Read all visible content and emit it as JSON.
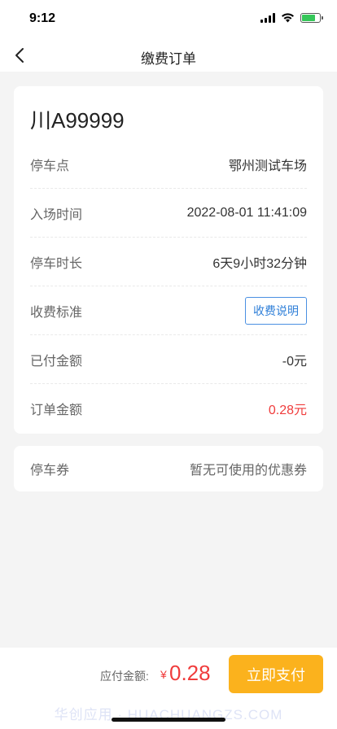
{
  "status_bar": {
    "time": "9:12",
    "battery_level": 0.75,
    "battery_color": "#35c759"
  },
  "nav": {
    "back_icon": "chevron-left-icon",
    "title": "缴费订单"
  },
  "order": {
    "plate": "川A99999",
    "rows": [
      {
        "label": "停车点",
        "value": "鄂州测试车场"
      },
      {
        "label": "入场时间",
        "value": "2022-08-01 11:41:09"
      },
      {
        "label": "停车时长",
        "value": "6天9小时32分钟"
      },
      {
        "label": "收费标准",
        "button": "收费说明"
      },
      {
        "label": "已付金额",
        "value": "-0元"
      },
      {
        "label": "订单金额",
        "value": "0.28元"
      }
    ]
  },
  "coupon": {
    "label": "停车券",
    "value": "暂无可使用的优惠券"
  },
  "bottom": {
    "pay_label": "应付金额:",
    "currency": "¥",
    "amount": "0.28",
    "pay_button": "立即支付",
    "watermark": "华创应用 · HUACHUANGZS.COM"
  },
  "colors": {
    "accent_red": "#f03c3c",
    "pay_button": "#fbb21d",
    "link_blue": "#2f7fd8"
  }
}
